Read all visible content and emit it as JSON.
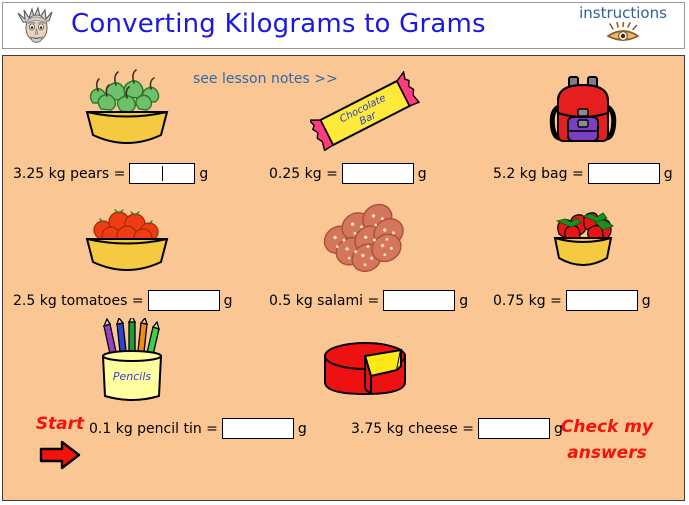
{
  "header": {
    "title": "Converting Kilograms to Grams",
    "mascot_icon": "einstein-face-icon",
    "instructions_label": "instructions",
    "instructions_icon": "eye-icon",
    "title_color": "#1b19e0",
    "background_color": "#ffffff"
  },
  "panel": {
    "background_color": "#fac794",
    "border_color": "#3d3d3d",
    "lesson_notes_link": "see lesson notes >>",
    "lesson_notes_color": "#2e6aa8"
  },
  "exercises": [
    {
      "id": "pears",
      "icon": "bowl-of-pears-icon",
      "label": "3.25 kg pears =",
      "value": "",
      "unit": "g",
      "focused": true
    },
    {
      "id": "chocolate",
      "icon": "chocolate-bar-icon",
      "icon_text_line1": "Chocolate",
      "icon_text_line2": "Bar",
      "label": "0.25 kg =",
      "value": "",
      "unit": "g",
      "focused": false
    },
    {
      "id": "bag",
      "icon": "backpack-icon",
      "label": "5.2 kg bag =",
      "value": "",
      "unit": "g",
      "focused": false
    },
    {
      "id": "tomatoes",
      "icon": "bowl-of-tomatoes-icon",
      "label": "2.5 kg tomatoes =",
      "value": "",
      "unit": "g",
      "focused": false
    },
    {
      "id": "salami",
      "icon": "salami-slices-icon",
      "label": "0.5 kg salami =",
      "value": "",
      "unit": "g",
      "focused": false
    },
    {
      "id": "strawberries",
      "icon": "bowl-of-strawberries-icon",
      "label": "0.75 kg =",
      "value": "",
      "unit": "g",
      "focused": false
    },
    {
      "id": "pencil-tin",
      "icon": "pencil-tin-icon",
      "icon_text": "Pencils",
      "label": "0.1 kg pencil tin =",
      "value": "",
      "unit": "g",
      "focused": false
    },
    {
      "id": "cheese",
      "icon": "cheese-wheel-icon",
      "label": "3.75 kg cheese =",
      "value": "",
      "unit": "g",
      "focused": false
    }
  ],
  "controls": {
    "start_label": "Start",
    "start_icon": "right-arrow-icon",
    "check_line1": "Check my",
    "check_line2": "answers",
    "action_color": "#f4120c"
  }
}
